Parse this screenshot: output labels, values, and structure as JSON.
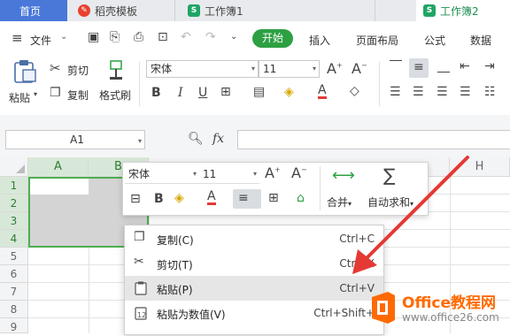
{
  "tabs": [
    {
      "label": "首页",
      "active": false
    },
    {
      "label": "稻壳模板",
      "active": false
    },
    {
      "label": "工作簿1",
      "active": false
    },
    {
      "label": "工作簿2",
      "active": true
    }
  ],
  "menu": {
    "file": "文件",
    "start": "开始",
    "insert": "插入",
    "page_layout": "页面布局",
    "formula": "公式",
    "data": "数据"
  },
  "ribbon": {
    "paste": "粘贴",
    "cut": "剪切",
    "copy": "复制",
    "format_painter": "格式刷",
    "font_name": "宋体",
    "font_size": "11",
    "bold": "B",
    "italic": "I",
    "underline": "U",
    "font_color_letter": "A"
  },
  "formula_bar": {
    "cell_ref": "A1",
    "fx": "fx"
  },
  "grid": {
    "columns": [
      "A",
      "B",
      "H"
    ],
    "rows": [
      "1",
      "2",
      "3",
      "4",
      "5",
      "6",
      "7",
      "8",
      "9"
    ]
  },
  "mini_toolbar": {
    "font_name": "宋体",
    "font_size": "11",
    "bold": "B",
    "font_color_letter": "A",
    "merge": "合并",
    "autosum": "自动求和"
  },
  "context_menu": [
    {
      "label": "复制(C)",
      "shortcut": "Ctrl+C",
      "icon": "copy-icon"
    },
    {
      "label": "剪切(T)",
      "shortcut": "Ctrl+X",
      "icon": "scissors-icon"
    },
    {
      "label": "粘贴(P)",
      "shortcut": "Ctrl+V",
      "icon": "paste-icon",
      "highlighted": true
    },
    {
      "label": "粘贴为数值(V)",
      "shortcut": "Ctrl+Shift+",
      "icon": "paste-values-icon"
    }
  ],
  "watermark": {
    "brand": "Office教程网",
    "url": "www.office26.com"
  },
  "colors": {
    "accent_green": "#2ea043",
    "tab_active_bg": "#ffffff",
    "tabbar_bg": "#e8eaed",
    "selection_fill": "#d4d4d4",
    "selection_border": "#4caf50",
    "arrow_red": "#e53935",
    "watermark_orange": "#ff6a00"
  }
}
